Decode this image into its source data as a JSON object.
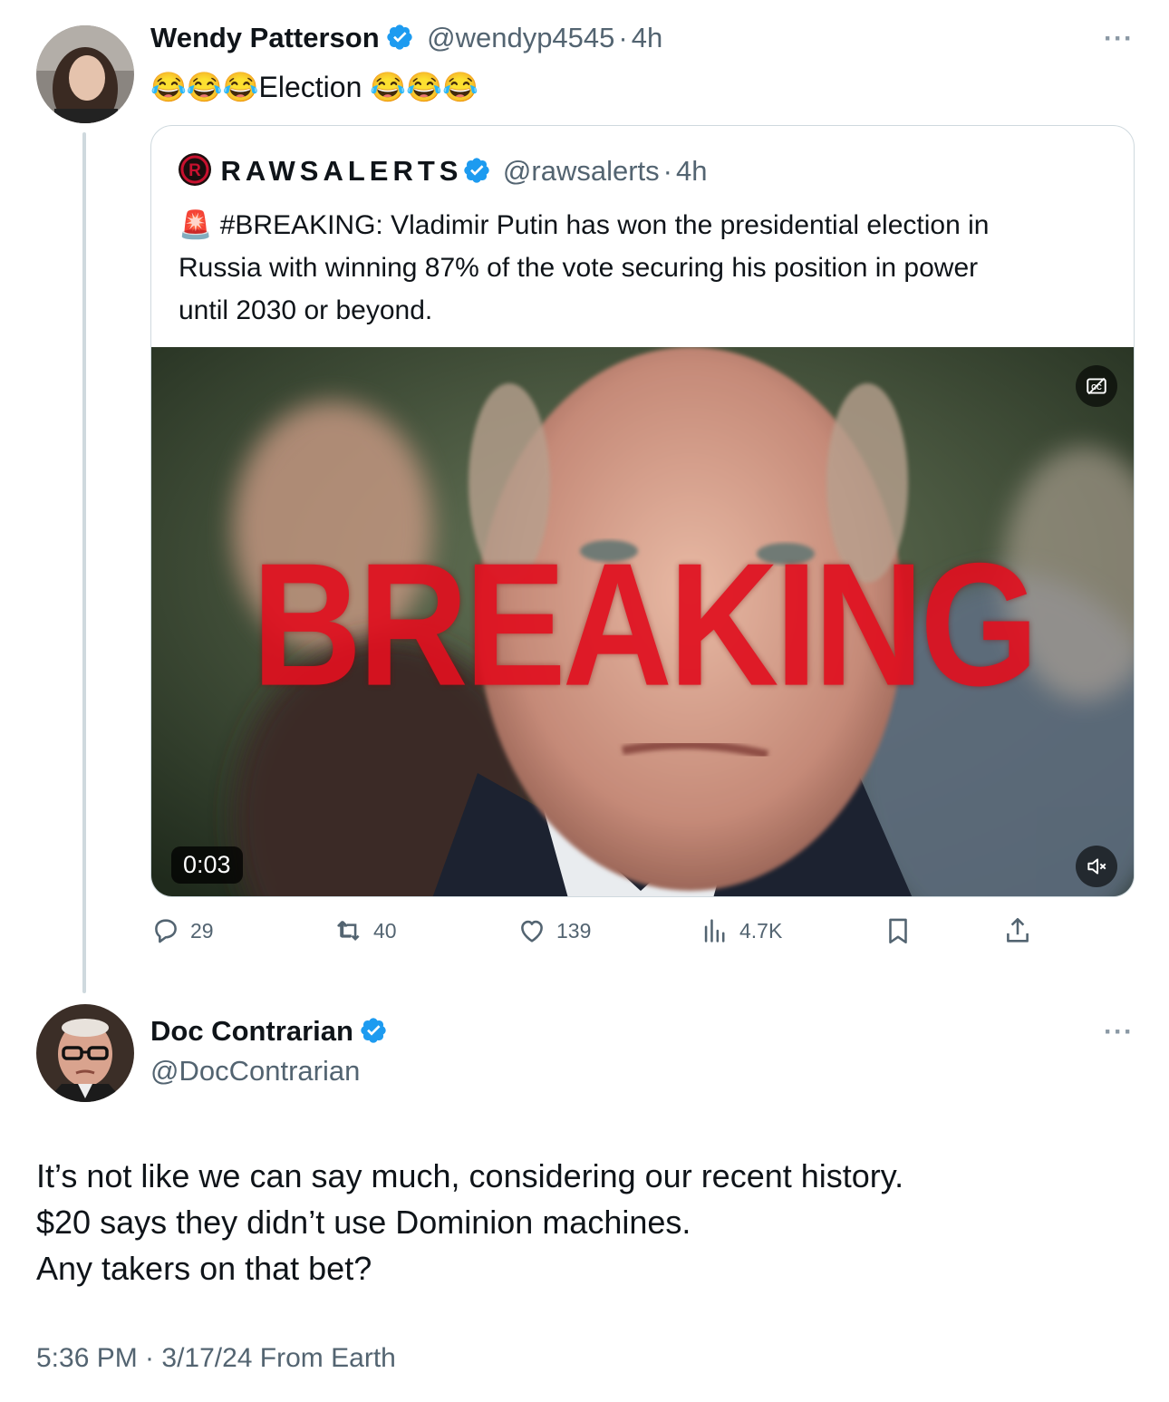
{
  "post1": {
    "author_name": "Wendy Patterson",
    "handle": "@wendyp4545",
    "sep": "·",
    "time": "4h",
    "text_emoji_before": "😂😂😂",
    "text_word": "Election",
    "text_emoji_after": "😂😂😂",
    "more": "···"
  },
  "quote": {
    "author_name": "RAWSALERTS",
    "handle": "@rawsalerts",
    "sep": "·",
    "time": "4h",
    "siren": "🚨",
    "text_line1": "#BREAKING: Vladimir Putin has won the presidential election in",
    "text_line2": "Russia with winning 87% of the vote securing his position in power",
    "text_line3": "until 2030 or beyond.",
    "media_overlay_text": "BREAKING",
    "video_duration": "0:03"
  },
  "actions": {
    "replies": "29",
    "reposts": "40",
    "likes": "139",
    "views": "4.7K"
  },
  "post2": {
    "author_name": "Doc Contrarian",
    "handle": "@DocContrarian",
    "more": "···",
    "line1": "It’s not like we can say much, considering our recent history.",
    "line2": "$20 says they didn’t use Dominion machines.",
    "line3": "Any takers on that bet?",
    "timestamp": "5:36 PM · 3/17/24 From Earth"
  },
  "colors": {
    "verified_blue": "#1d9bf0",
    "secondary_text": "#536471",
    "breaking_red": "#e0101f"
  },
  "icons": [
    "verified-icon",
    "reply-icon",
    "repost-icon",
    "like-icon",
    "views-icon",
    "bookmark-icon",
    "share-icon",
    "captions-icon",
    "mute-icon",
    "more-icon"
  ]
}
